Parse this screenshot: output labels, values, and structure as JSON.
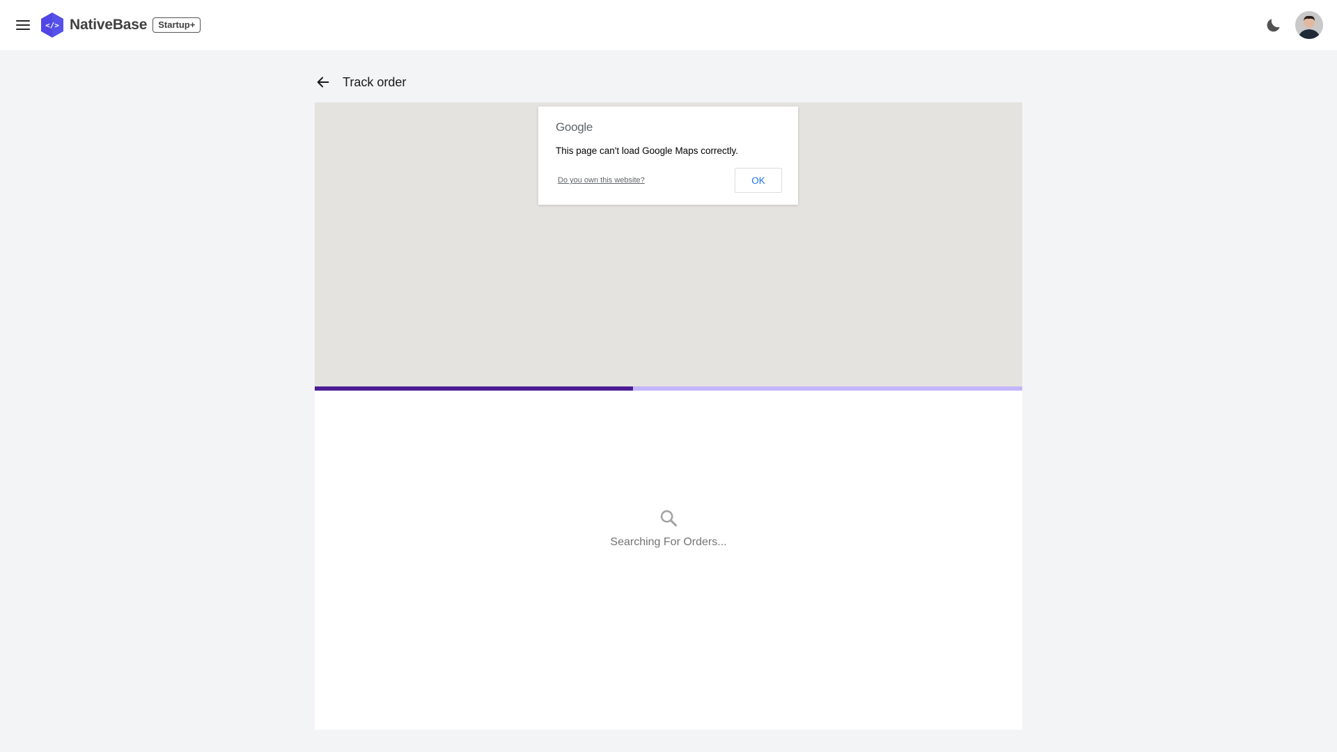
{
  "header": {
    "brand": "NativeBase",
    "plan_badge": "Startup+"
  },
  "page": {
    "title": "Track order"
  },
  "map": {
    "provider_logo": "Google",
    "error_message": "This page can't load Google Maps correctly.",
    "own_site_link": "Do you own this website?",
    "ok_button": "OK"
  },
  "progress": {
    "value": 0.45,
    "fill_color": "#4c1d95",
    "track_color": "#c4b5fd"
  },
  "status": {
    "text": "Searching For Orders...",
    "icon": "search-icon"
  },
  "colors": {
    "brand": "#5b47e8"
  }
}
